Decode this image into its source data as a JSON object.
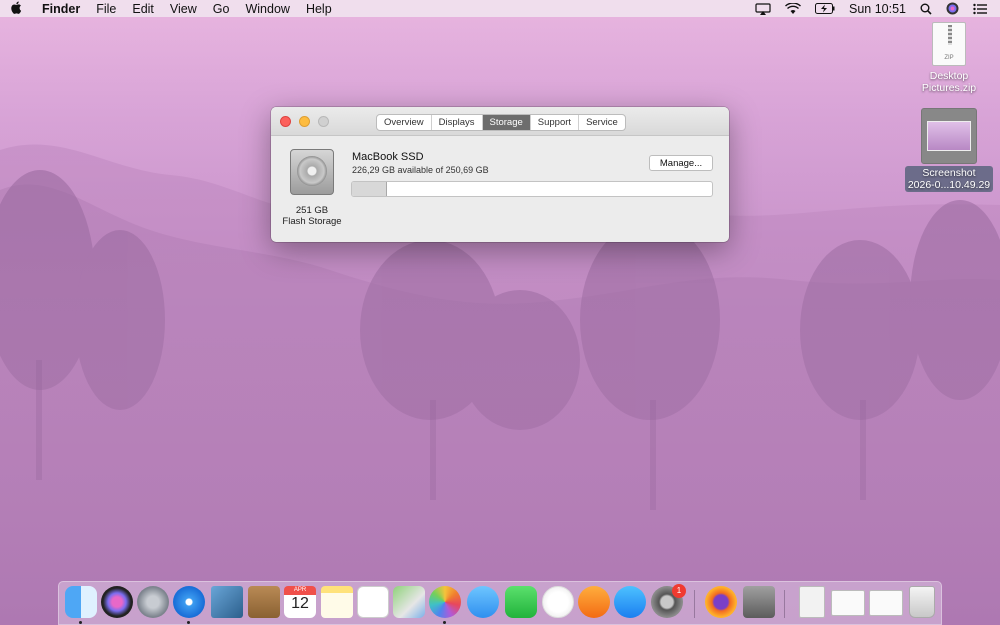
{
  "menubar": {
    "app_name": "Finder",
    "menus": [
      "File",
      "Edit",
      "View",
      "Go",
      "Window",
      "Help"
    ],
    "clock": "Sun 10:51"
  },
  "desktop": {
    "zip_file": {
      "label": "Desktop Pictures.zip",
      "doc_text": "ZIP"
    },
    "screenshot_file": {
      "label_line1": "Screenshot",
      "label_line2": "2026-0...10.49.29"
    }
  },
  "window": {
    "tabs": [
      {
        "label": "Overview",
        "active": false
      },
      {
        "label": "Displays",
        "active": false
      },
      {
        "label": "Storage",
        "active": true
      },
      {
        "label": "Support",
        "active": false
      },
      {
        "label": "Service",
        "active": false
      }
    ],
    "disk": {
      "caption_line1": "251 GB",
      "caption_line2": "Flash Storage",
      "name": "MacBook SSD",
      "available": "226,29 GB available of 250,69 GB",
      "used_fraction": 0.097
    },
    "manage_label": "Manage..."
  },
  "dock": {
    "calendar": {
      "month": "APR",
      "day": "12"
    },
    "system_prefs_badge": "1"
  },
  "colors": {
    "close": "#fc605c",
    "minimize": "#fdbc40",
    "active_tab": "#6d6d6d"
  }
}
